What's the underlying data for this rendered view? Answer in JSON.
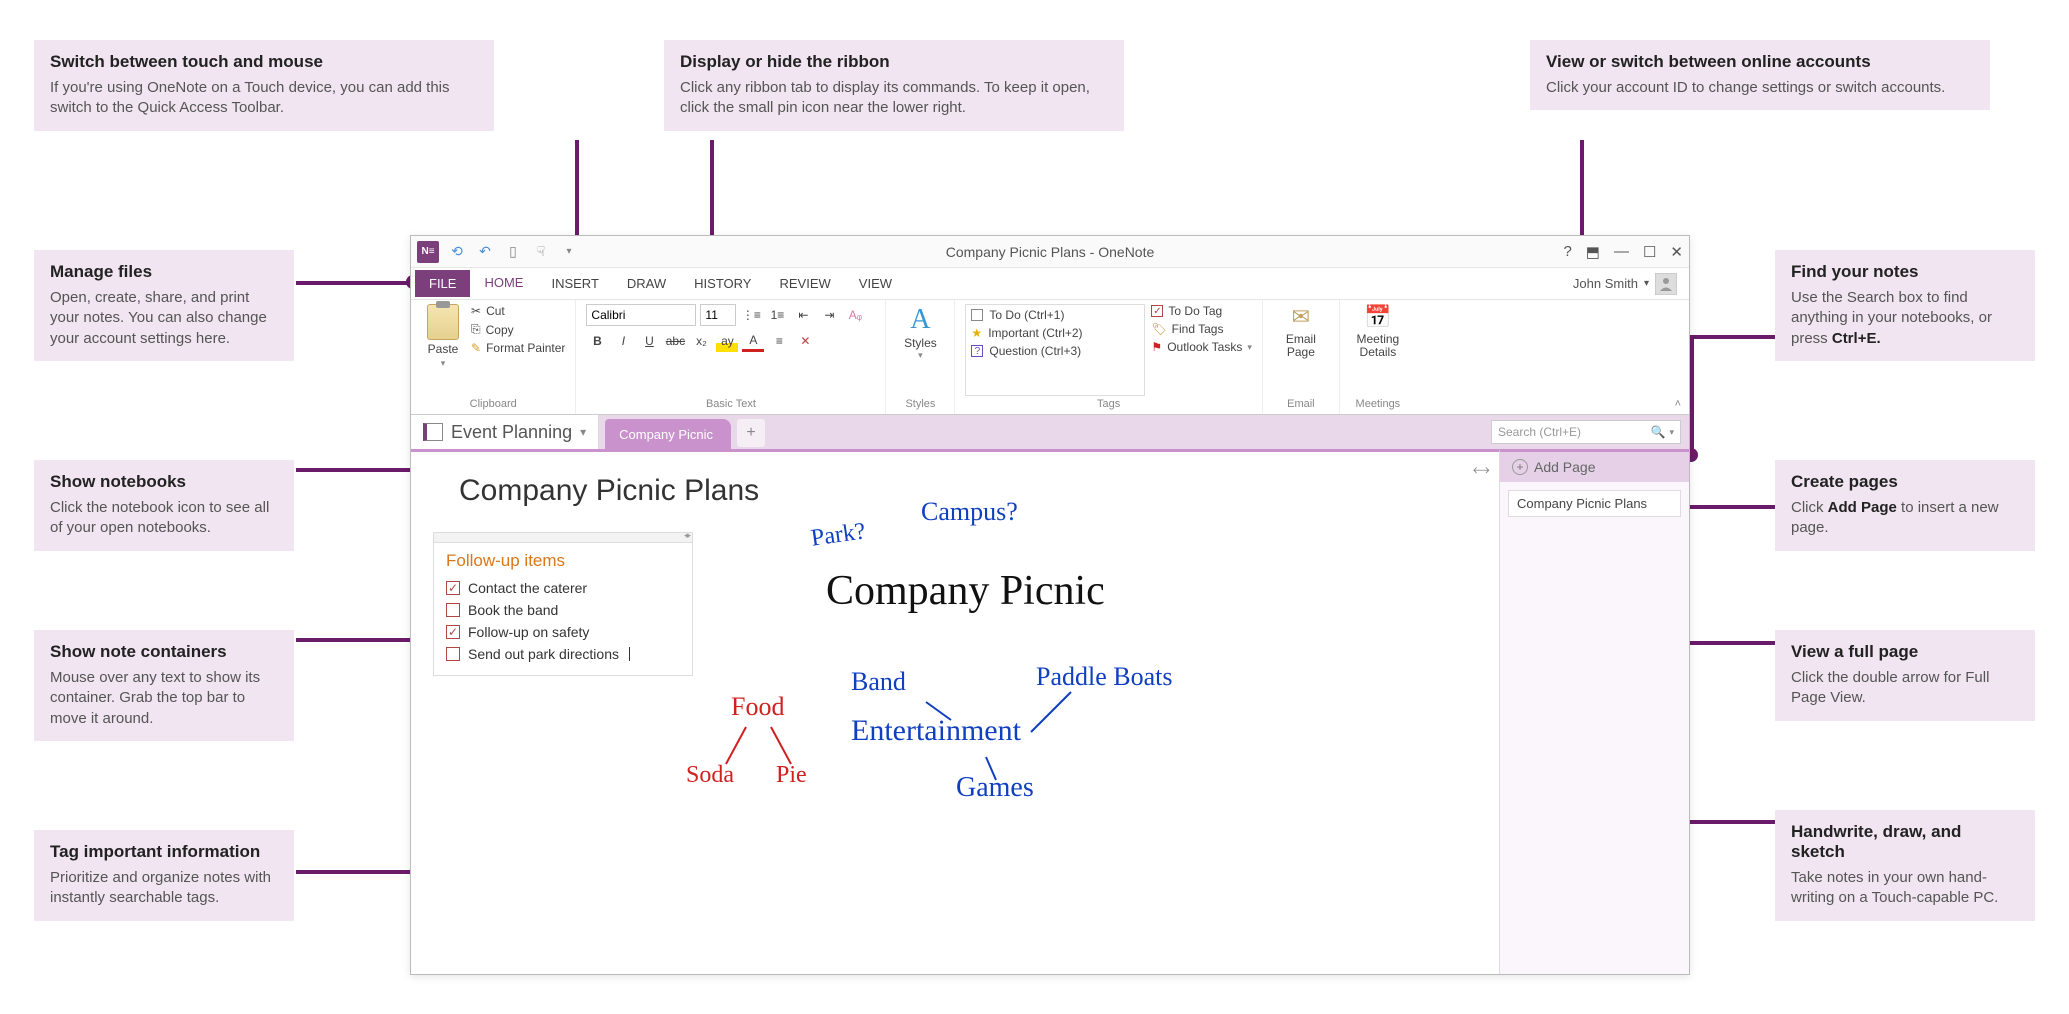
{
  "callouts": {
    "touch": {
      "title": "Switch between touch and mouse",
      "body": "If you're using OneNote on a Touch device, you can add this switch to the Quick Access Toolbar."
    },
    "ribbon": {
      "title": "Display or hide the ribbon",
      "body": "Click any ribbon tab to display its commands. To keep it open, click the small pin icon near the lower right."
    },
    "accounts": {
      "title": "View or switch between online accounts",
      "body": "Click your account ID to change settings or switch accounts."
    },
    "manage": {
      "title": "Manage files",
      "body": "Open, create, share, and print your notes. You can also change your account settings here."
    },
    "find": {
      "title": "Find your notes",
      "body_pre": "Use the Search box to find anything in your notebooks, or press ",
      "body_bold": "Ctrl+E."
    },
    "notebooks": {
      "title": "Show notebooks",
      "body": "Click the notebook icon to see all of your open notebooks."
    },
    "createpages": {
      "title": "Create pages",
      "body_pre": "Click ",
      "body_bold": "Add Page",
      "body_post": " to insert a new page."
    },
    "containers": {
      "title": "Show note containers",
      "body": "Mouse over any text to show its container. Grab the top bar to move it around."
    },
    "fullpage": {
      "title": "View a full page",
      "body": "Click the double arrow for Full Page View."
    },
    "tag": {
      "title": "Tag important information",
      "body": "Prioritize and organize notes with instantly searchable tags."
    },
    "handwrite": {
      "title": "Handwrite, draw, and sketch",
      "body": "Take notes in your own hand-writing on a Touch-capable PC."
    }
  },
  "window_title": "Company Picnic Plans - OneNote",
  "account_name": "John Smith",
  "tabs": {
    "file": "FILE",
    "home": "HOME",
    "insert": "INSERT",
    "draw": "DRAW",
    "history": "HISTORY",
    "review": "REVIEW",
    "view": "VIEW"
  },
  "ribbon": {
    "paste": "Paste",
    "cut": "Cut",
    "copy": "Copy",
    "format_painter": "Format Painter",
    "clipboard_label": "Clipboard",
    "font_name": "Calibri",
    "font_size": "11",
    "basictext_label": "Basic Text",
    "styles": "Styles",
    "styles_label": "Styles",
    "tag_todo": "To Do (Ctrl+1)",
    "tag_important": "Important (Ctrl+2)",
    "tag_question": "Question (Ctrl+3)",
    "todo_tag": "To Do Tag",
    "find_tags": "Find Tags",
    "outlook_tasks": "Outlook Tasks",
    "tags_label": "Tags",
    "email_page": "Email Page",
    "email_label": "Email",
    "meeting_details": "Meeting Details",
    "meetings_label": "Meetings"
  },
  "notebook_name": "Event Planning",
  "section_name": "Company Picnic",
  "search_placeholder": "Search (Ctrl+E)",
  "add_page_label": "Add Page",
  "page_list_item": "Company Picnic Plans",
  "page_title": "Company Picnic Plans",
  "note_container": {
    "title": "Follow-up items",
    "items": [
      {
        "checked": true,
        "text": "Contact the caterer"
      },
      {
        "checked": false,
        "text": "Book the band"
      },
      {
        "checked": true,
        "text": "Follow-up on safety"
      },
      {
        "checked": false,
        "text": "Send out park directions"
      }
    ]
  },
  "handwriting": {
    "park": "Park?",
    "campus": "Campus?",
    "title": "Company Picnic",
    "band": "Band",
    "paddle": "Paddle Boats",
    "entertainment": "Entertainment",
    "games": "Games",
    "food": "Food",
    "soda": "Soda",
    "pie": "Pie"
  }
}
